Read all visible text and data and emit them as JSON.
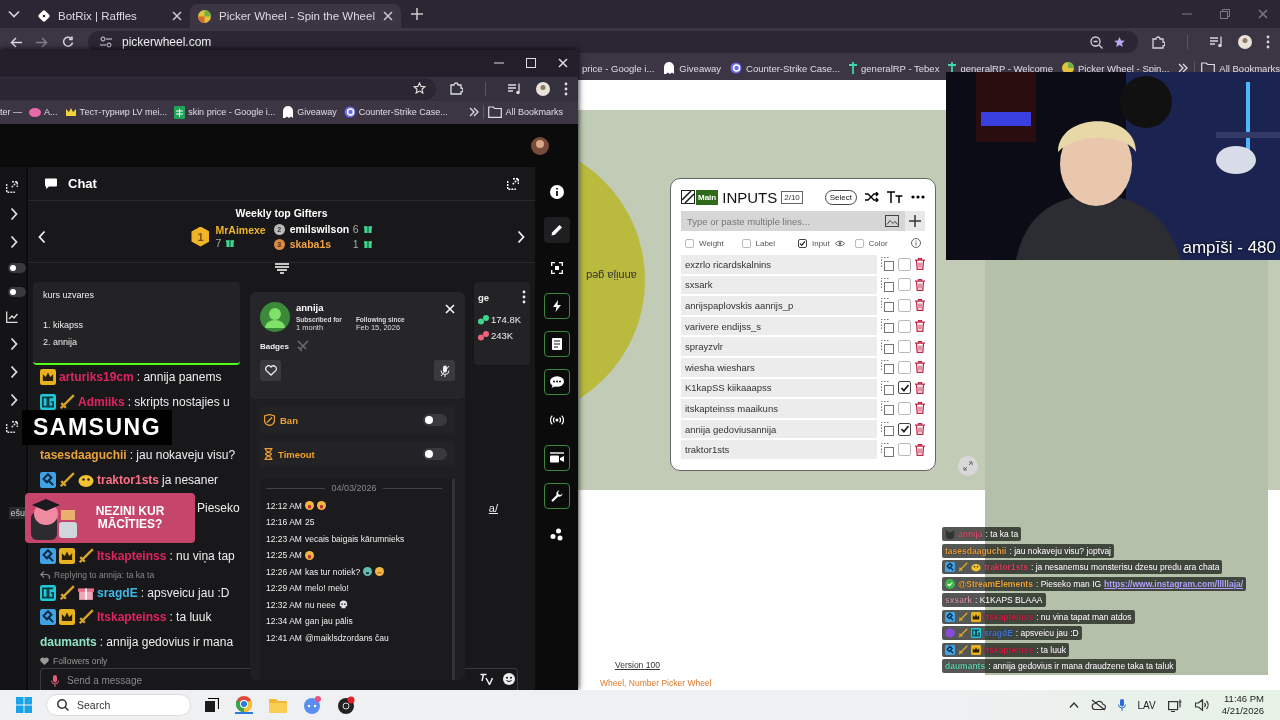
{
  "back_browser": {
    "tabs": [
      {
        "title": "BotRix | Raffles",
        "selected": false
      },
      {
        "title": "Picker Wheel - Spin the Wheel",
        "selected": true
      }
    ],
    "url": "pickerwheel.com",
    "bookmarks": [
      "price - Google i...",
      "Giveaway",
      "Counter-Strike Case...",
      "generalRP - Tebex",
      "generalRP - Welcome",
      "Picker Wheel - Spin..."
    ],
    "all_bookmarks": "All Bookmarks"
  },
  "picker_wheel": {
    "wheel_label": "annija ged",
    "inputs": {
      "tag": "Main",
      "title": "INPUTS",
      "count": "2/10",
      "select": "Select",
      "placeholder": "Type or paste multiple lines...",
      "options": [
        {
          "label": "Weight",
          "checked": false
        },
        {
          "label": "Label",
          "checked": false
        },
        {
          "label": "Input",
          "checked": true
        },
        {
          "label": "Color",
          "checked": false
        }
      ],
      "entries": [
        {
          "text": "exzrlo ricardskalnins",
          "checked": false
        },
        {
          "text": "sxsark",
          "checked": false
        },
        {
          "text": "anrijspaplovskis  aanrijs_p",
          "checked": false
        },
        {
          "text": "varivere endijss_s",
          "checked": false
        },
        {
          "text": "sprayzvlr",
          "checked": false
        },
        {
          "text": "wiesha wieshars",
          "checked": false
        },
        {
          "text": "K1kapSS kiikaaapss",
          "checked": true
        },
        {
          "text": "itskapteinss maaikuns",
          "checked": false
        },
        {
          "text": "annija gedoviusannija",
          "checked": true
        },
        {
          "text": "traktor1sts",
          "checked": false
        }
      ]
    },
    "version": "Version 100",
    "footer_link": "Wheel, Number Picker Wheel"
  },
  "webcam": {
    "kind": "picture",
    "overlay_text": "ampīši - 480"
  },
  "stream_chat": [
    {
      "user": "annija",
      "color": "#d35370",
      "text": ": ta ka ta"
    },
    {
      "user": "tasesdaaguchii",
      "color": "#e39a3b",
      "text": ": jau nokaveju visu? joptvaj"
    },
    {
      "user": "traktor1sts",
      "color": "#d83a5a",
      "text": ": ja nesanemsu monsterisu dzesu predu ara chata"
    },
    {
      "user": "@StreamElements",
      "color": "#eaa336",
      "text": ": Pieseko man IG",
      "link": "https://www.instagram.com/lllllaja/"
    },
    {
      "user": "sxsark",
      "color": "#c78aa0",
      "text": ": K1KAPS BLAAA"
    },
    {
      "user": "Itskapteinss",
      "color": "#c41f3e",
      "text": ": nu vina tapat man atdos"
    },
    {
      "user": "sragdE",
      "color": "#3f73d0",
      "text": ": apsveicu jau :D"
    },
    {
      "user": "Itskapteinss",
      "color": "#c41f3e",
      "text": ": ta luuk"
    },
    {
      "user": "daumants",
      "color": "#5fcfae",
      "text": ": annija gedovius ir mana draudzene taka ta taluk"
    }
  ],
  "front_browser": {
    "bookmarks": [
      "ter —",
      "A...",
      "Тест-турнир LV mei...",
      "skin price - Google i...",
      "Giveaway",
      "Counter-Strike Case..."
    ],
    "all_bookmarks": "All Bookmarks"
  },
  "kick": {
    "left_strip_text": "ešu",
    "left_strip_toggles": [
      {
        "on": false
      },
      {
        "on": false
      }
    ],
    "chat_title": "Chat",
    "gifters": {
      "title": "Weekly top Gifters",
      "top": {
        "rank": "1",
        "name": "MrAimexe",
        "count": "7"
      },
      "others": [
        {
          "rank": "2",
          "name": "emilswilson",
          "count": "6",
          "color": "#ffffff"
        },
        {
          "rank": "3",
          "name": "skaba1s",
          "count": "1",
          "color": "#f0a446"
        }
      ]
    },
    "pinned": {
      "title": "kurs uzvares",
      "items": [
        "1. kikapss",
        "2. annija"
      ]
    },
    "side_card": {
      "label": "ge",
      "stats": [
        {
          "value": "174.8K",
          "color": "#3dd68c"
        },
        {
          "value": "243K",
          "color": "#f0627a"
        }
      ]
    },
    "feed": [
      {
        "kind": "message",
        "user": "arturiks19cm",
        "color": "#e0245e",
        "text": ": annija panems"
      },
      {
        "kind": "message",
        "user": "Admiiks",
        "color": "#e0245e",
        "text": ": skripts nostajies u"
      },
      {
        "kind": "brand_ad",
        "text": "SAMSUNG"
      },
      {
        "kind": "message",
        "user": "tasesdaaguchii",
        "color": "#e8a33a",
        "text": ": jau nokaveju visu?"
      },
      {
        "kind": "message",
        "user": "traktor1sts",
        "color": "#ff6f87",
        "text": "ja nesaner"
      },
      {
        "kind": "promo_ad",
        "text": "NEZINI KUR MĀCĪTIES?",
        "beside_text": "Pieseko",
        "tail": "a/"
      },
      {
        "kind": "message",
        "user": "Itskapteinss",
        "color": "#e0245e",
        "text": ": nu viņa tap"
      },
      {
        "kind": "reply",
        "text": "Replying to annija: ta ka ta"
      },
      {
        "kind": "message",
        "user": "sragdE",
        "color": "#3fb8e8",
        "text": ": apsveicu jau :D"
      },
      {
        "kind": "message",
        "user": "Itskapteinss",
        "color": "#e0245e",
        "text": ": ta luuk"
      },
      {
        "kind": "message",
        "user": "daumants",
        "color": "#8fe3c4",
        "text": ": annija gedovius ir mana"
      }
    ],
    "followers_only": "Followers only",
    "message_placeholder": "Send a message",
    "user_card": {
      "name": "annija",
      "subscribed_label": "Subscribed for",
      "subscribed_value": "1 month",
      "following_label": "Following since",
      "following_value": "Feb 15, 2026",
      "badges_label": "Badges",
      "actions": [
        {
          "label": "Ban",
          "kind": "ban",
          "on": false
        },
        {
          "label": "Timeout",
          "kind": "timeout",
          "on": false
        }
      ],
      "history_date": "04/03/2026",
      "history": [
        {
          "time": "12:12 AM"
        },
        {
          "time": "12:16 AM",
          "text": "25"
        },
        {
          "time": "12:23 AM",
          "text": "vecais baigais kārumnieks"
        },
        {
          "time": "12:25 AM"
        },
        {
          "time": "12:26 AM",
          "text": "kas tur notiek?"
        },
        {
          "time": "12:29 AM",
          "text": "melo! melo!"
        },
        {
          "time": "12:32 AM",
          "text": "nu neee"
        },
        {
          "time": "12:34 AM",
          "text": "gan jau pālis"
        },
        {
          "time": "12:41 AM",
          "text": "@maiklsdzordans čau"
        }
      ]
    }
  },
  "taskbar": {
    "search": "Search",
    "language": "LAV",
    "time": "11:46 PM",
    "date": "4/21/2026"
  }
}
